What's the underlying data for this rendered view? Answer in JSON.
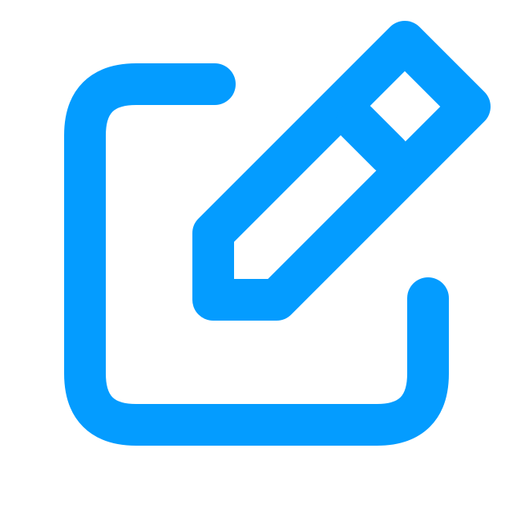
{
  "icon": {
    "name": "edit-icon",
    "color": "#049cff",
    "background": "#ffffff"
  }
}
